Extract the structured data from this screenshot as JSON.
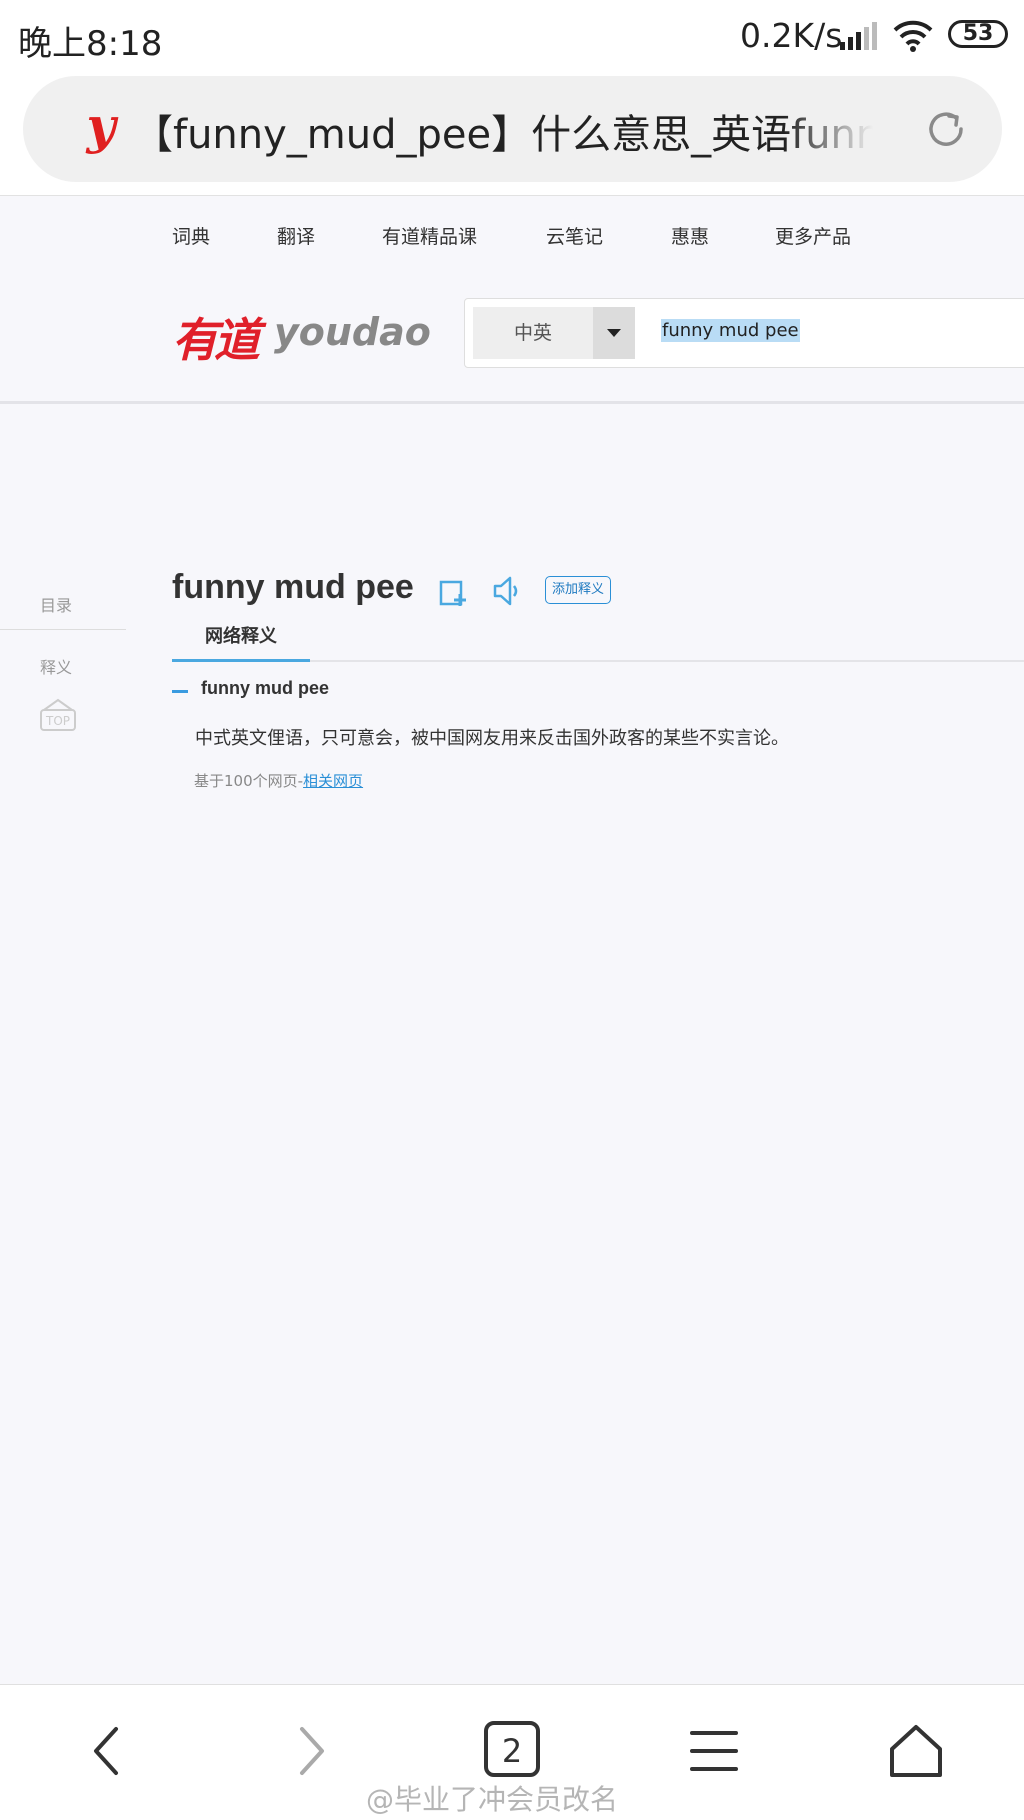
{
  "status_bar": {
    "time": "晚上8:18",
    "net_speed": "0.2K/s",
    "battery": "53"
  },
  "browser": {
    "site_icon": "y",
    "page_title": "【funny_mud_pee】什么意思_英语funny_mud_pee的翻译_音标_读音_用法_例句_在线翻译_有道词典",
    "tabs_count": "2"
  },
  "site": {
    "nav": [
      "词典",
      "翻译",
      "有道精品课",
      "云笔记",
      "惠惠",
      "更多产品"
    ],
    "logo_cn": "有道",
    "logo_en": "youdao",
    "lang_select": "中英",
    "query": "funny mud pee"
  },
  "sidebar": {
    "toc_title": "目录",
    "item": "释义",
    "top_label": "TOP"
  },
  "main": {
    "word": "funny mud pee",
    "add_def_label": "添加释义",
    "tab_web": "网络释义",
    "def_word": "funny mud pee",
    "def_text": "中式英文俚语，只可意会，被中国网友用来反击国外政客的某些不实言论。",
    "source_prefix": "基于100个网页-",
    "source_link": "相关网页"
  },
  "watermark": "@毕业了冲会员改名",
  "colors": {
    "accent_blue": "#2a8fd6",
    "brand_red": "#e0202a",
    "background": "#f7f7fb"
  }
}
